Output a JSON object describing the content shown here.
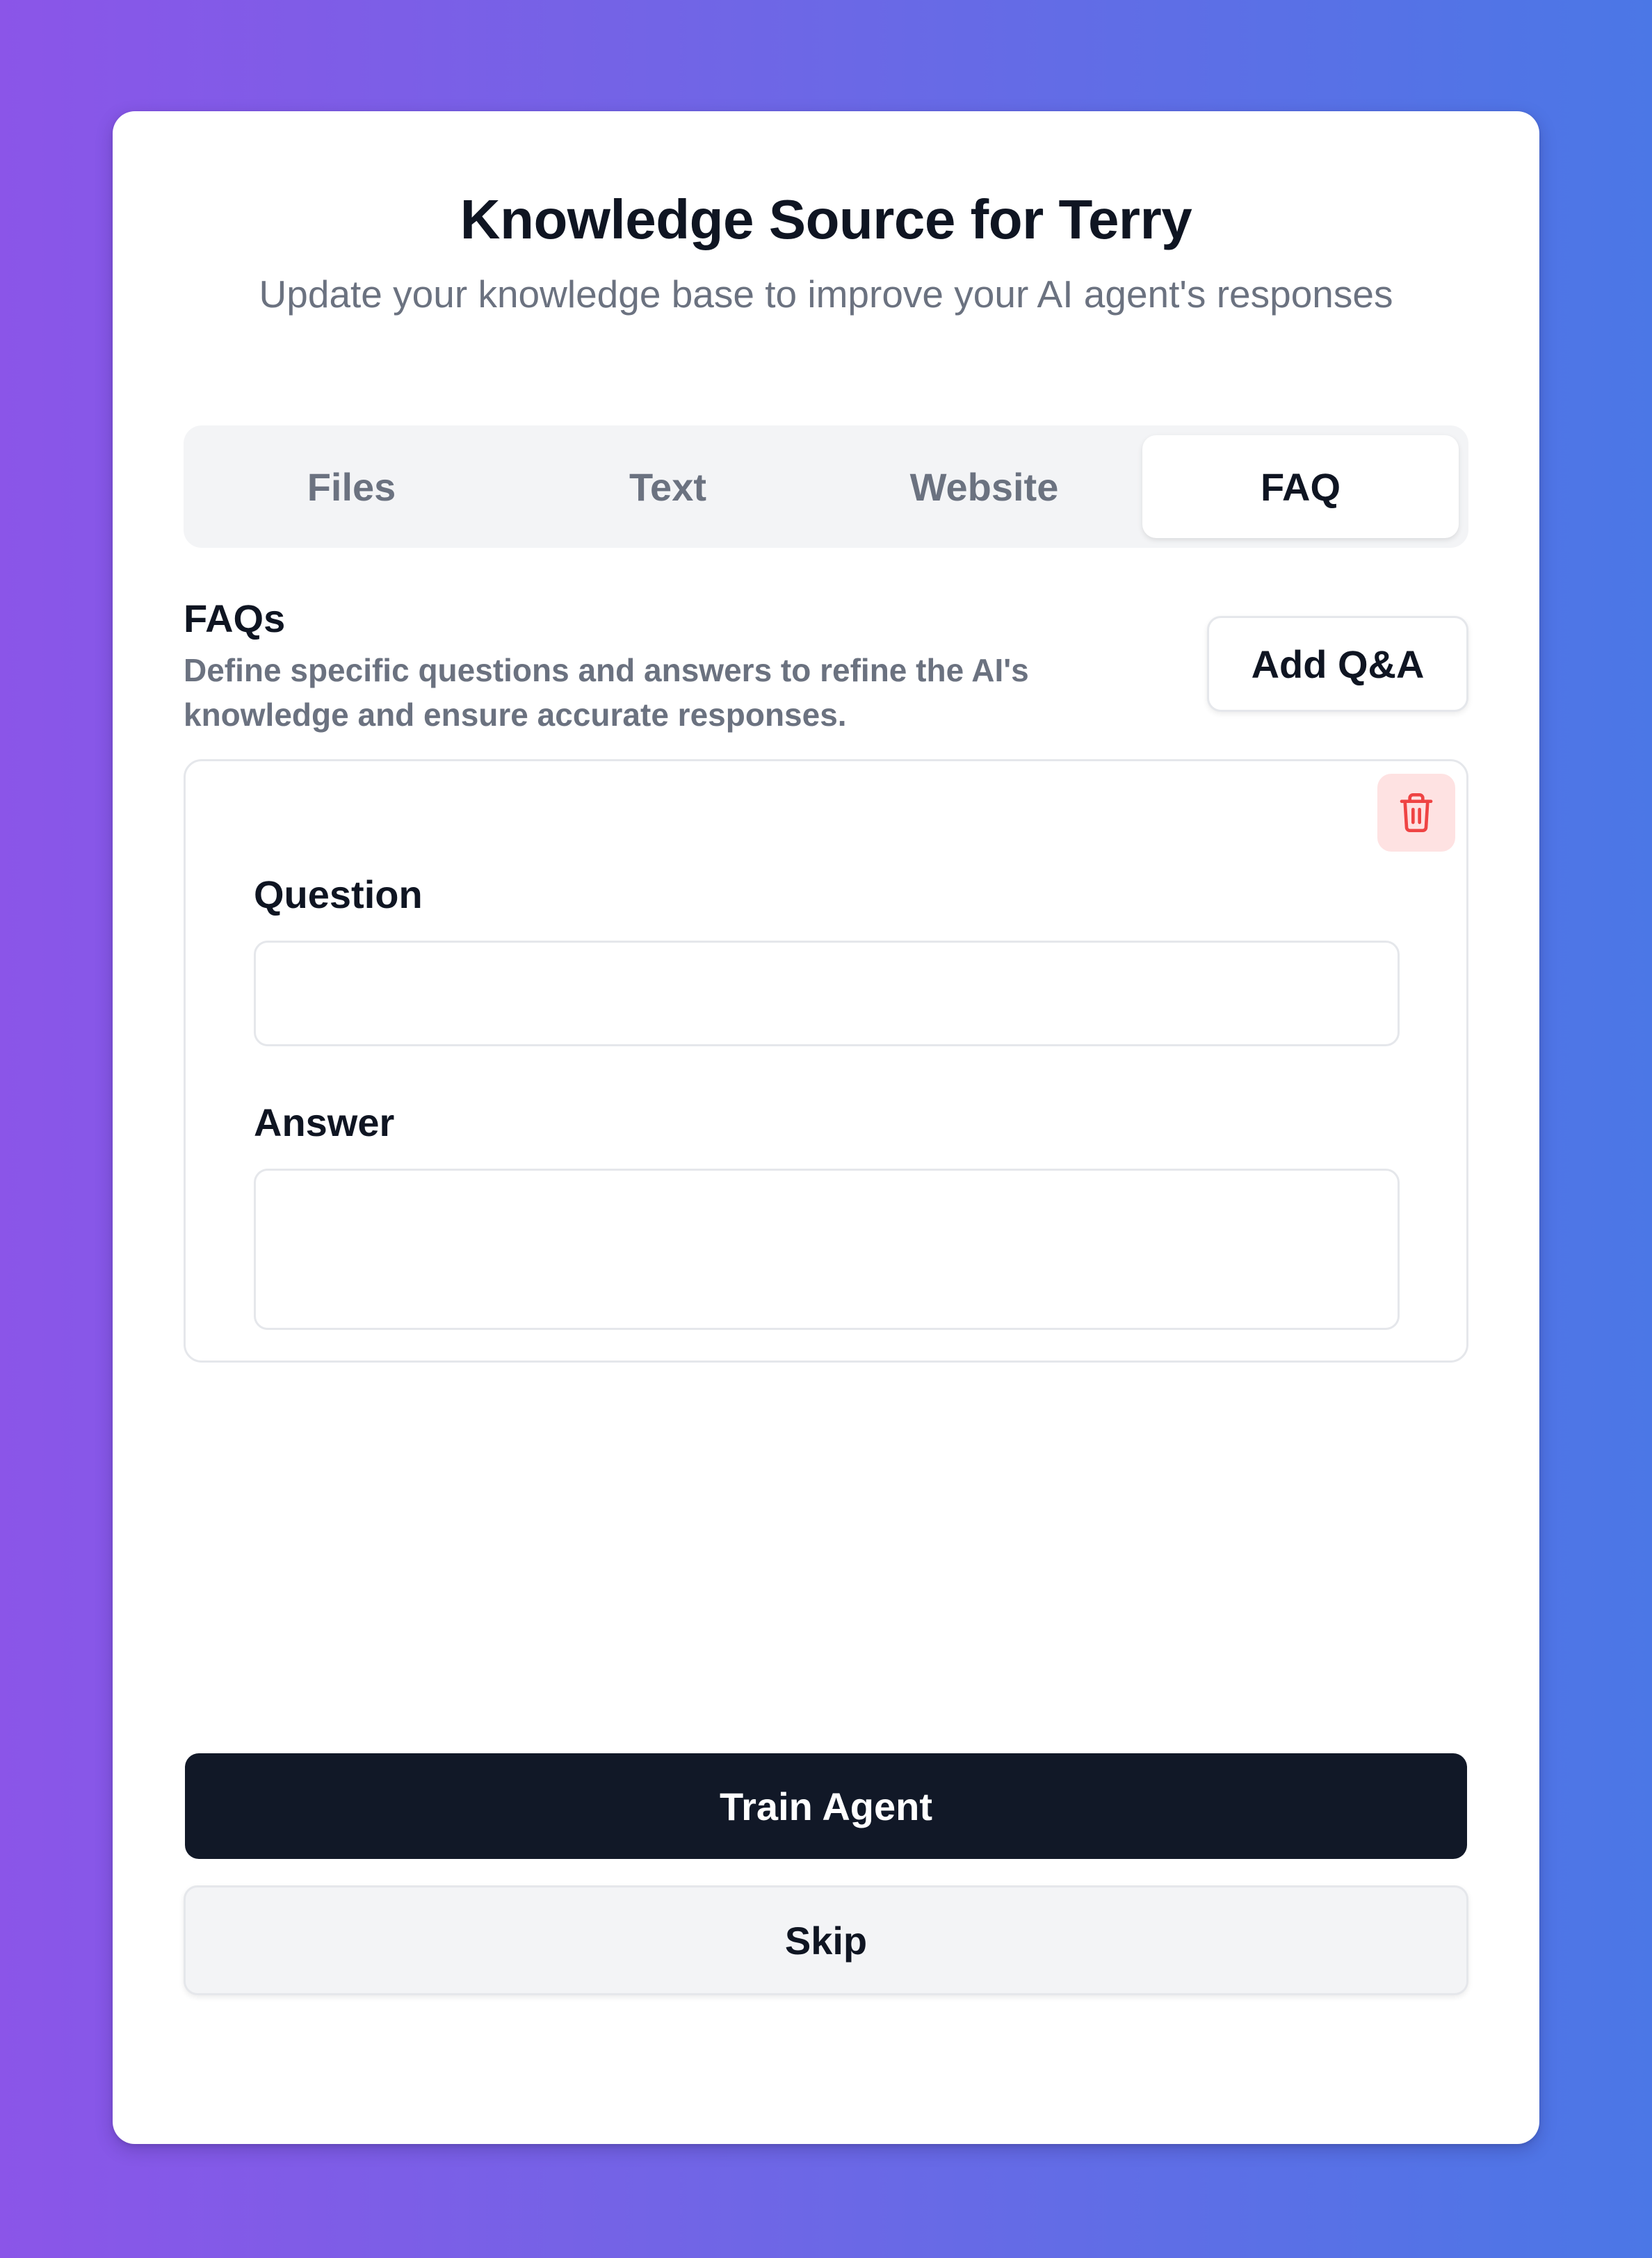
{
  "header": {
    "title": "Knowledge Source for Terry",
    "subtitle": "Update your knowledge base to improve your AI agent's responses"
  },
  "tabs": [
    {
      "label": "Files",
      "active": false
    },
    {
      "label": "Text",
      "active": false
    },
    {
      "label": "Website",
      "active": false
    },
    {
      "label": "FAQ",
      "active": true
    }
  ],
  "faq": {
    "heading": "FAQs",
    "description": "Define specific questions and answers to refine the AI's knowledge and ensure accurate responses.",
    "add_button_label": "Add Q&A",
    "items": [
      {
        "question_label": "Question",
        "question_value": "",
        "answer_label": "Answer",
        "answer_value": "",
        "delete_icon": "trash-icon"
      }
    ]
  },
  "actions": {
    "train_label": "Train Agent",
    "skip_label": "Skip"
  },
  "colors": {
    "primary_button": "#111827",
    "delete_icon": "#ef4444",
    "delete_bg": "#fee2e2",
    "muted_text": "#6b7280"
  }
}
